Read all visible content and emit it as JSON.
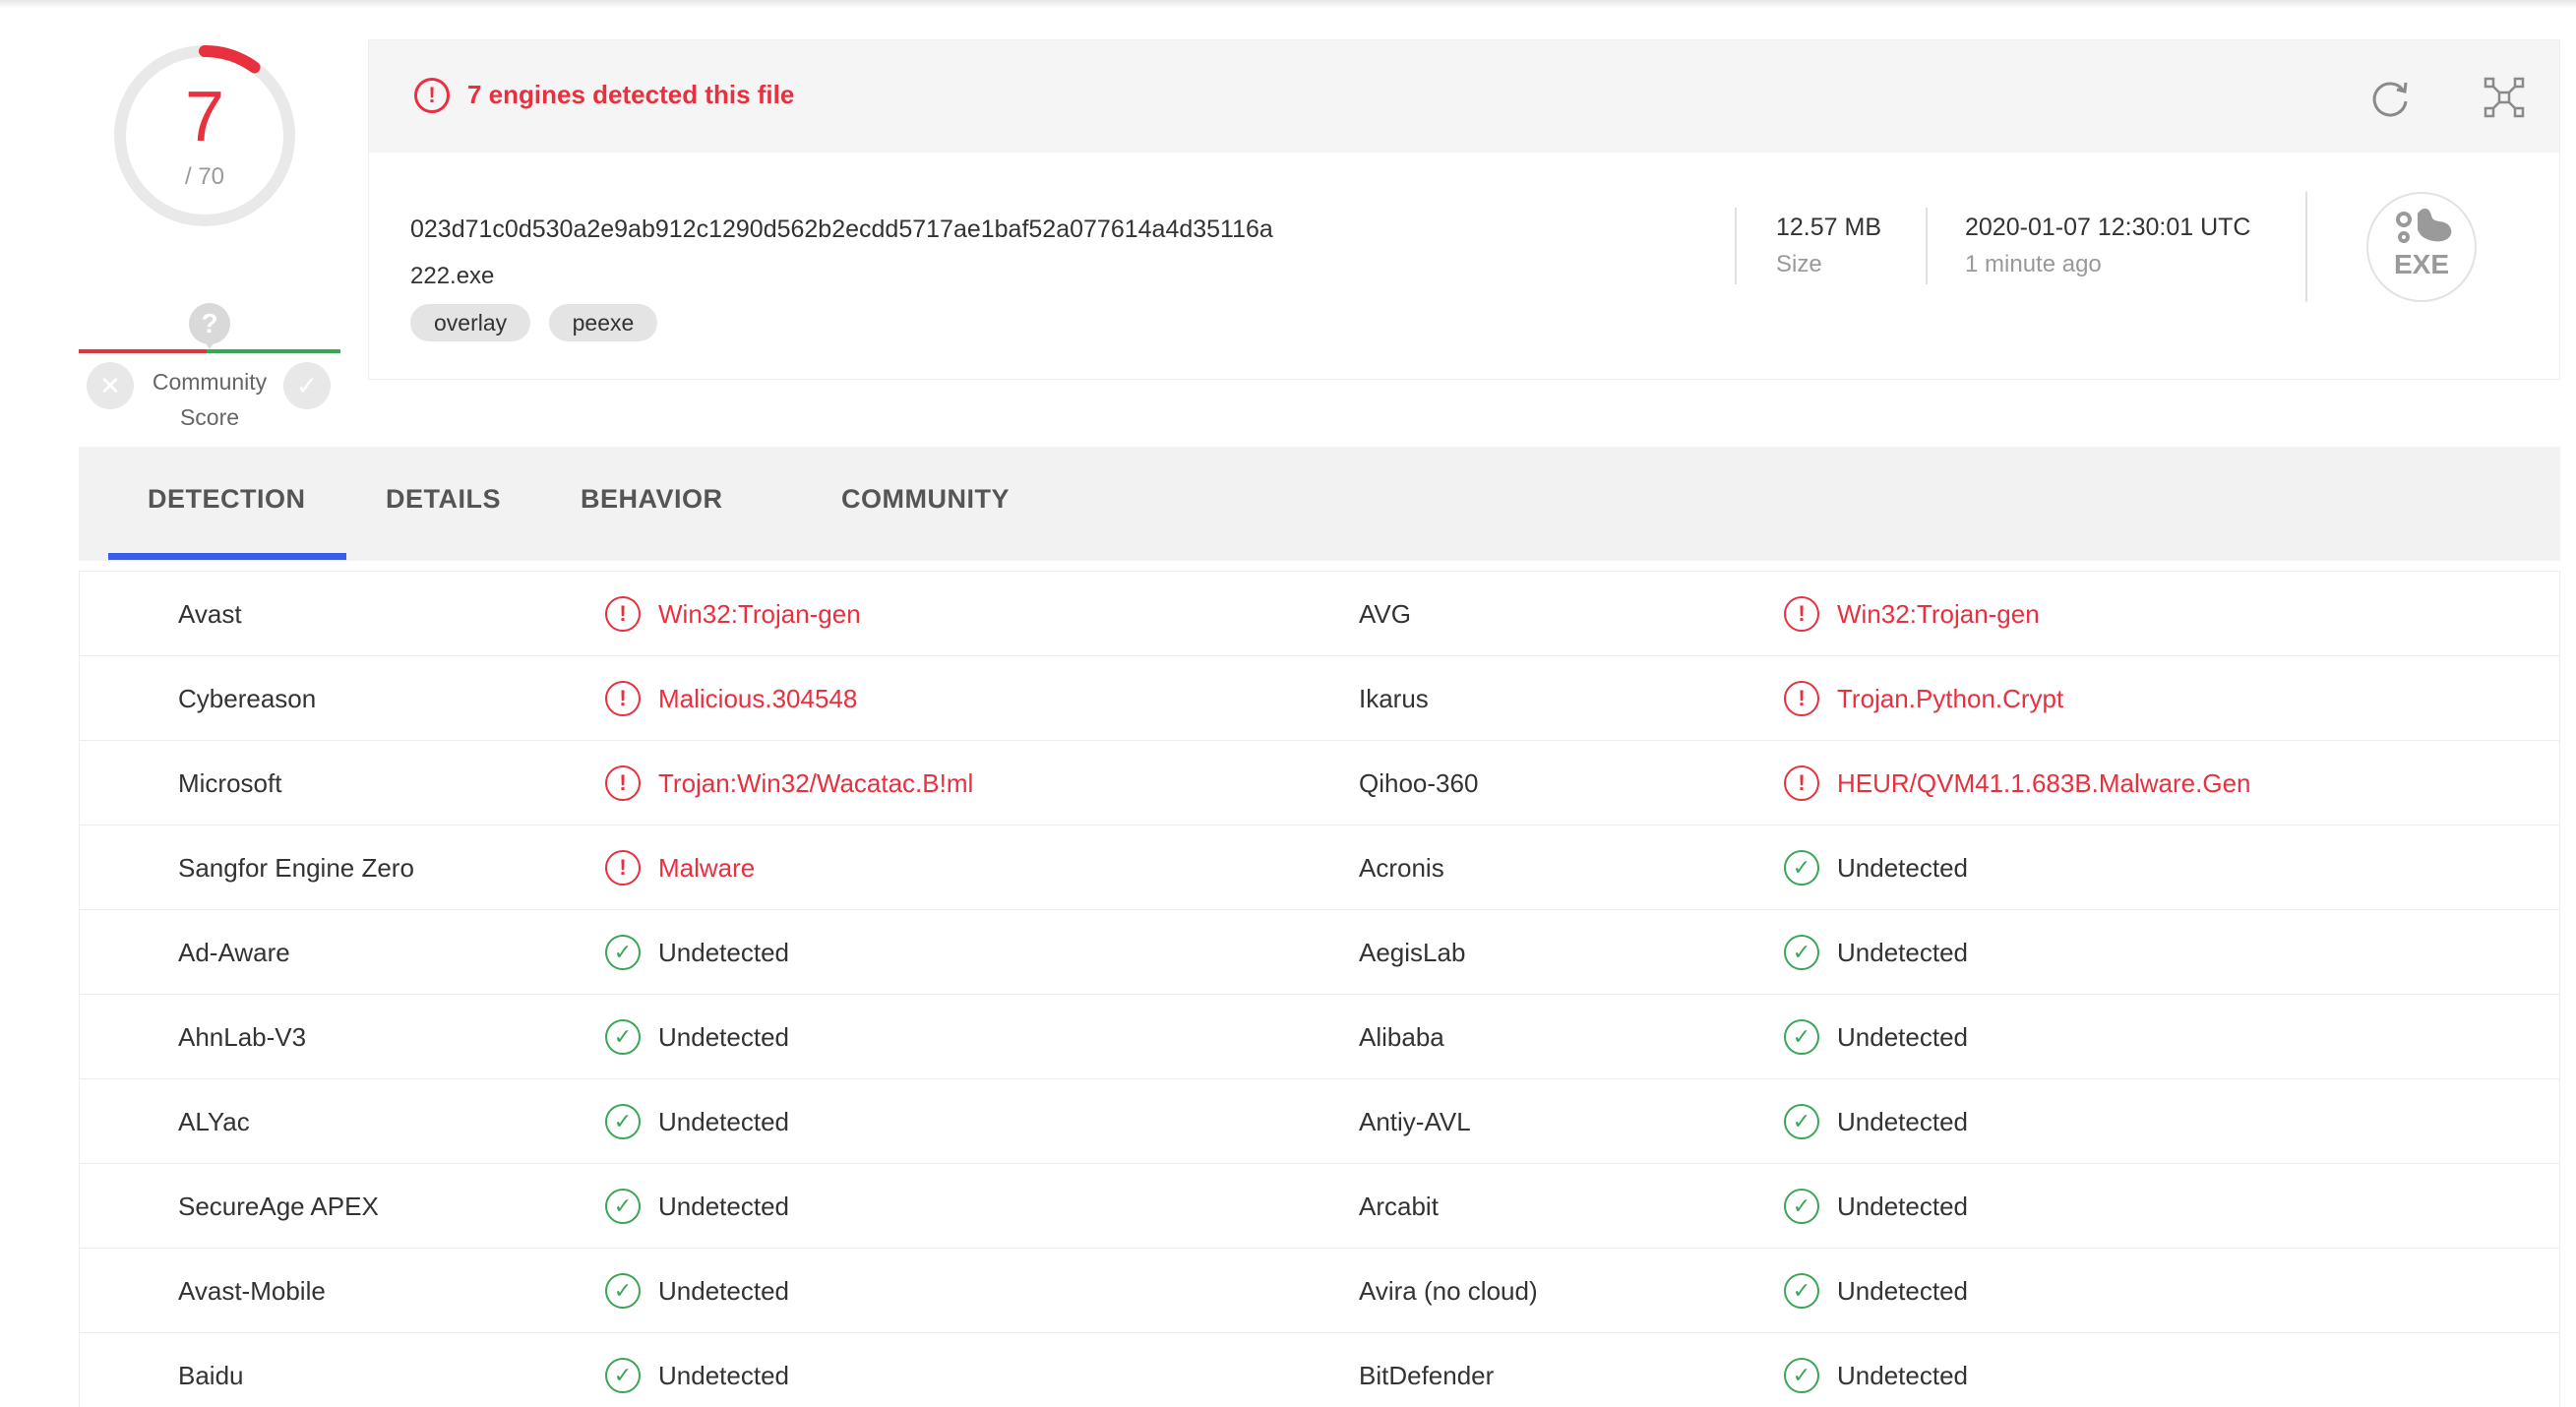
{
  "score": {
    "detected": "7",
    "total": "/ 70",
    "ring_fraction": 0.1,
    "community_label": "Community Score",
    "community_question": "?"
  },
  "header": {
    "alert_text": "7 engines detected this file",
    "hash": "023d71c0d530a2e9ab912c1290d562b2ecdd5717ae1baf52a077614a4d35116a",
    "filename": "222.exe",
    "tags": [
      "overlay",
      "peexe"
    ],
    "size_value": "12.57 MB",
    "size_label": "Size",
    "date_value": "2020-01-07 12:30:01 UTC",
    "date_label": "1 minute ago",
    "filetype_badge": "EXE"
  },
  "tabs": {
    "detection": "DETECTION",
    "details": "DETAILS",
    "behavior": "BEHAVIOR",
    "community": "COMMUNITY"
  },
  "colors": {
    "malicious": "#e8303f",
    "clean": "#3aa757",
    "accent": "#3b5ce6"
  },
  "detections": [
    {
      "engine_left": "Avast",
      "status_left": "bad",
      "result_left": "Win32:Trojan-gen",
      "engine_right": "AVG",
      "status_right": "bad",
      "result_right": "Win32:Trojan-gen"
    },
    {
      "engine_left": "Cybereason",
      "status_left": "bad",
      "result_left": "Malicious.304548",
      "engine_right": "Ikarus",
      "status_right": "bad",
      "result_right": "Trojan.Python.Crypt"
    },
    {
      "engine_left": "Microsoft",
      "status_left": "bad",
      "result_left": "Trojan:Win32/Wacatac.B!ml",
      "engine_right": "Qihoo-360",
      "status_right": "bad",
      "result_right": "HEUR/QVM41.1.683B.Malware.Gen"
    },
    {
      "engine_left": "Sangfor Engine Zero",
      "status_left": "bad",
      "result_left": "Malware",
      "engine_right": "Acronis",
      "status_right": "ok",
      "result_right": "Undetected"
    },
    {
      "engine_left": "Ad-Aware",
      "status_left": "ok",
      "result_left": "Undetected",
      "engine_right": "AegisLab",
      "status_right": "ok",
      "result_right": "Undetected"
    },
    {
      "engine_left": "AhnLab-V3",
      "status_left": "ok",
      "result_left": "Undetected",
      "engine_right": "Alibaba",
      "status_right": "ok",
      "result_right": "Undetected"
    },
    {
      "engine_left": "ALYac",
      "status_left": "ok",
      "result_left": "Undetected",
      "engine_right": "Antiy-AVL",
      "status_right": "ok",
      "result_right": "Undetected"
    },
    {
      "engine_left": "SecureAge APEX",
      "status_left": "ok",
      "result_left": "Undetected",
      "engine_right": "Arcabit",
      "status_right": "ok",
      "result_right": "Undetected"
    },
    {
      "engine_left": "Avast-Mobile",
      "status_left": "ok",
      "result_left": "Undetected",
      "engine_right": "Avira (no cloud)",
      "status_right": "ok",
      "result_right": "Undetected"
    },
    {
      "engine_left": "Baidu",
      "status_left": "ok",
      "result_left": "Undetected",
      "engine_right": "BitDefender",
      "status_right": "ok",
      "result_right": "Undetected"
    }
  ]
}
